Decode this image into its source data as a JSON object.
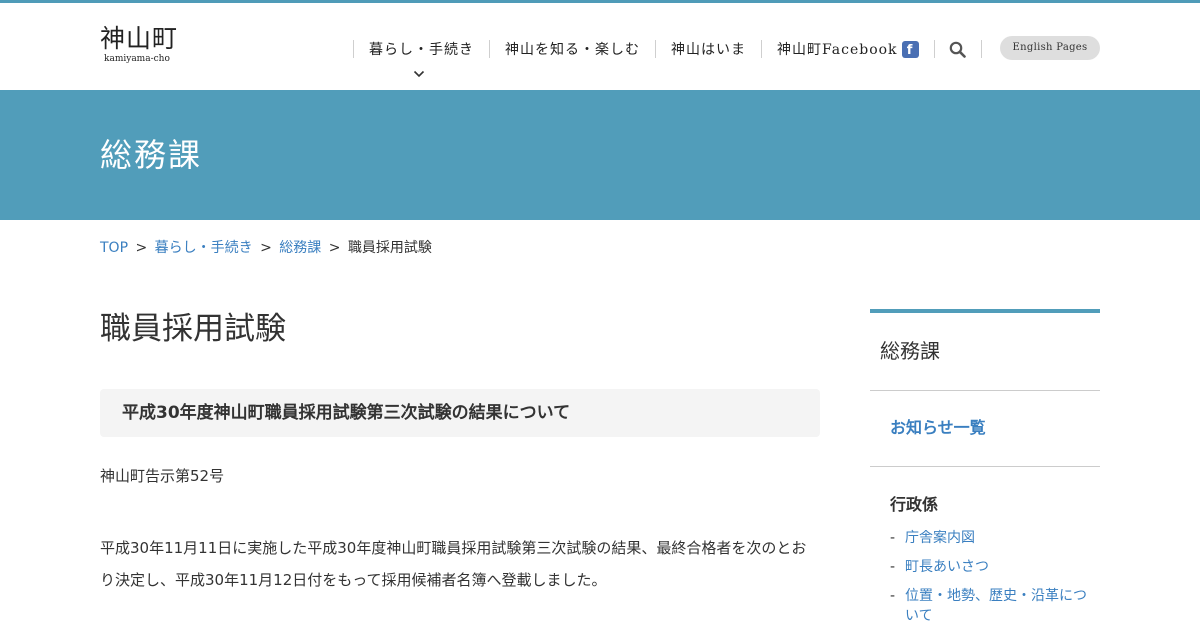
{
  "colors": {
    "accent": "#519dba",
    "link": "#3a7fc0",
    "text": "#333333",
    "subheading_bg": "#f4f4f4",
    "facebook": "#4a6fb3"
  },
  "header": {
    "logo_kanji": "神山町",
    "logo_roman": "kamiyama-cho",
    "nav": [
      {
        "label": "暮らし・手続き"
      },
      {
        "label": "神山を知る・楽しむ"
      },
      {
        "label": "神山はいま"
      },
      {
        "label": "神山町Facebook",
        "badge": "f"
      }
    ],
    "search_icon": "search-icon",
    "dropdown_icon": "chevron-down-icon",
    "english_label": "English Pages"
  },
  "banner": {
    "title": "総務課"
  },
  "breadcrumb": [
    {
      "label": "TOP"
    },
    {
      "label": "暮らし・手続き"
    },
    {
      "label": "総務課"
    },
    {
      "label": "職員採用試験"
    }
  ],
  "breadcrumb_separator": ">",
  "main": {
    "title": "職員採用試験",
    "subheading": "平成30年度神山町職員採用試験第三次試験の結果について",
    "notice_number": "神山町告示第52号",
    "paragraph": "平成30年11月11日に実施した平成30年度神山町職員採用試験第三次試験の結果、最終合格者を次のとおり決定し、平成30年11月12日付をもって採用候補者名簿へ登載しました。"
  },
  "sidebar": {
    "title": "総務課",
    "news_link": "お知らせ一覧",
    "section_title": "行政係",
    "bullet": "-",
    "links": [
      {
        "label": "庁舎案内図"
      },
      {
        "label": "町長あいさつ"
      },
      {
        "label": "位置・地勢、歴史・沿革について"
      }
    ]
  }
}
